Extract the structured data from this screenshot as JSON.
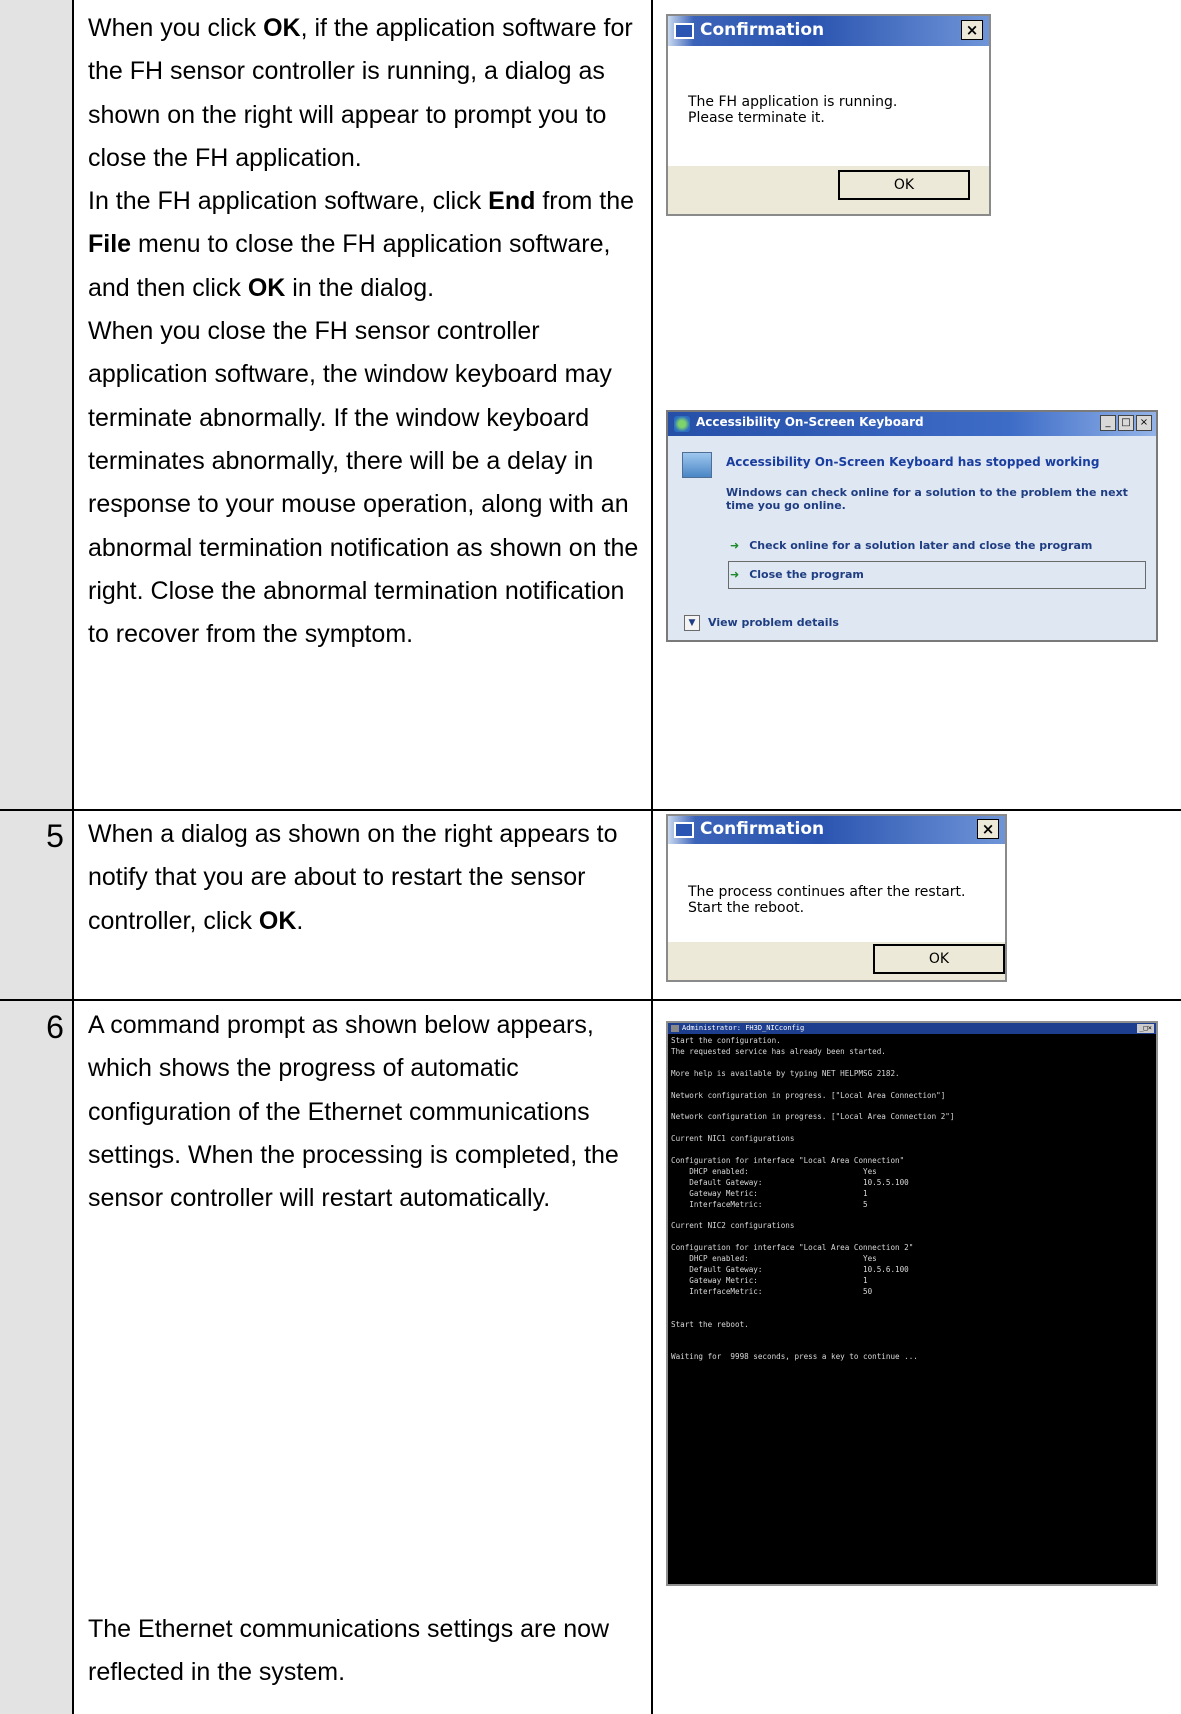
{
  "row_top": {
    "paragraphs": [
      [
        "When you click ",
        {
          "b": "OK"
        },
        ", if the application software for the FH sensor controller is running, a dialog as shown on the right will appear to prompt you to close the FH application."
      ],
      [
        "In the FH application software, click ",
        {
          "b": "End"
        },
        " from the ",
        {
          "b": "File"
        },
        " menu to close the FH application software, and then click ",
        {
          "b": "OK"
        },
        " in the dialog."
      ],
      [
        "When you close the FH sensor controller application software, the window keyboard may terminate abnormally. If the window keyboard terminates abnormally, there will be a delay in response to your mouse operation, along with an abnormal termination notification as shown on the right. Close the abnormal termination notification to recover from the symptom."
      ]
    ],
    "dialog": {
      "title": "Confirmation",
      "close": "×",
      "message": "The FH application is running.\nPlease terminate it.",
      "ok": "OK"
    },
    "error_dialog": {
      "title": "Accessibility On-Screen Keyboard",
      "controls": [
        "_",
        "□",
        "×"
      ],
      "heading": "Accessibility On-Screen Keyboard has stopped working",
      "description": "Windows can check online for a solution to the problem the next time you go online.",
      "option1": "Check online for a solution later and close the program",
      "option2": "Close the program",
      "details": "View problem details"
    }
  },
  "row_5": {
    "number": "5",
    "paragraph": [
      "When a dialog as shown on the right appears to notify that you are about to restart the sensor controller, click ",
      {
        "b": "OK"
      },
      "."
    ],
    "dialog": {
      "title": "Confirmation",
      "close": "×",
      "message": "The process continues after the restart.\nStart the reboot.",
      "ok": "OK"
    }
  },
  "row_6": {
    "number": "6",
    "paragraph": "A command prompt as shown below appears, which shows the progress of automatic configuration of the Ethernet communications settings. When the processing is completed, the sensor controller will restart automatically.",
    "footer": "The Ethernet communications settings are now reflected in the system.",
    "cmd": {
      "title": "Administrator: FH3D_NICconfig",
      "controls": "_□×",
      "lines": [
        "Start the configuration.",
        "The requested service has already been started.",
        "",
        "More help is available by typing NET HELPMSG 2182.",
        "",
        "Network configuration in progress. [\"Local Area Connection\"]",
        "",
        "Network configuration in progress. [\"Local Area Connection 2\"]",
        "",
        "Current NIC1 configurations",
        "",
        "Configuration for interface \"Local Area Connection\"",
        "    DHCP enabled:                         Yes",
        "    Default Gateway:                      10.5.5.100",
        "    Gateway Metric:                       1",
        "    InterfaceMetric:                      5",
        "",
        "Current NIC2 configurations",
        "",
        "Configuration for interface \"Local Area Connection 2\"",
        "    DHCP enabled:                         Yes",
        "    Default Gateway:                      10.5.6.100",
        "    Gateway Metric:                       1",
        "    InterfaceMetric:                      50",
        "",
        "",
        "Start the reboot.",
        "",
        "",
        "Waiting for  9998 seconds, press a key to continue ..."
      ]
    }
  }
}
